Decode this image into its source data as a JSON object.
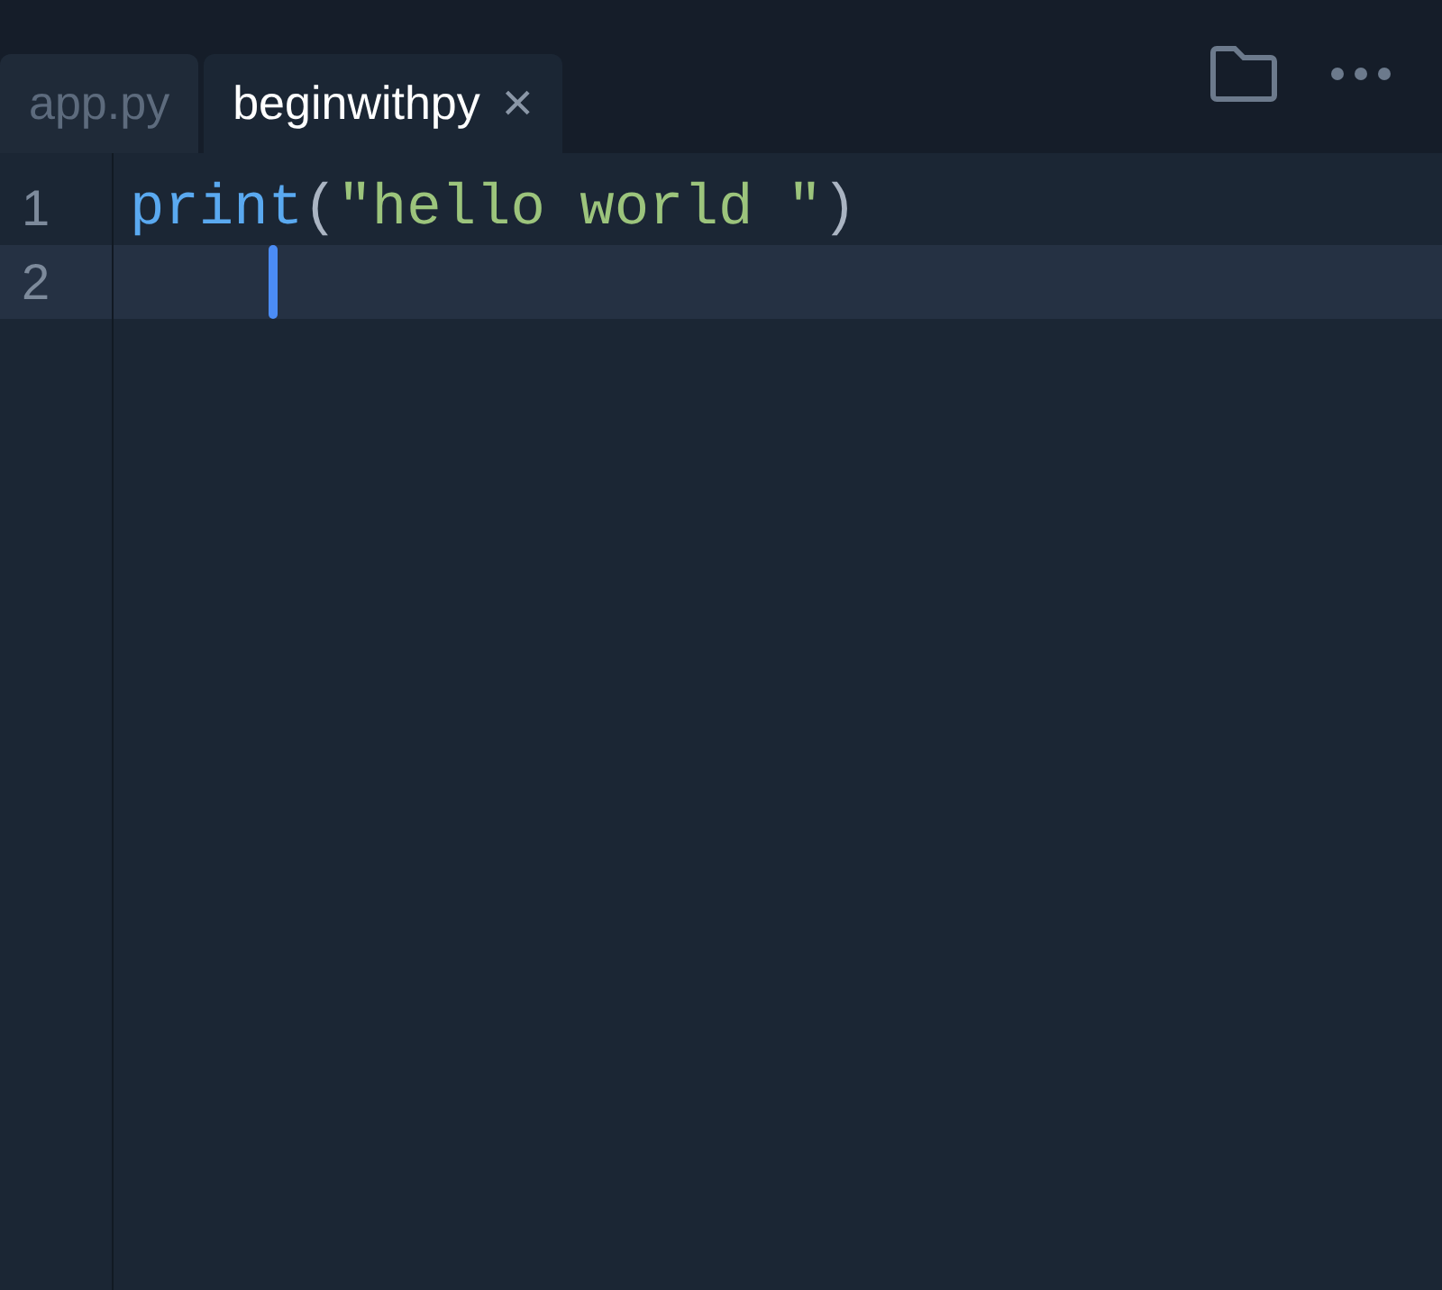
{
  "tabs": [
    {
      "label": "app.py",
      "selected": false,
      "closable": false
    },
    {
      "label": "beginwithpy",
      "selected": true,
      "closable": true
    }
  ],
  "close_glyph": "×",
  "editor": {
    "lines": [
      {
        "number": "1",
        "current": false,
        "cursor": false,
        "tokens": [
          {
            "kind": "function",
            "text": "print"
          },
          {
            "kind": "punct",
            "text": "("
          },
          {
            "kind": "string",
            "text": "\"hello world \""
          },
          {
            "kind": "punct",
            "text": ")"
          }
        ]
      },
      {
        "number": "2",
        "current": true,
        "cursor": true
      }
    ]
  }
}
